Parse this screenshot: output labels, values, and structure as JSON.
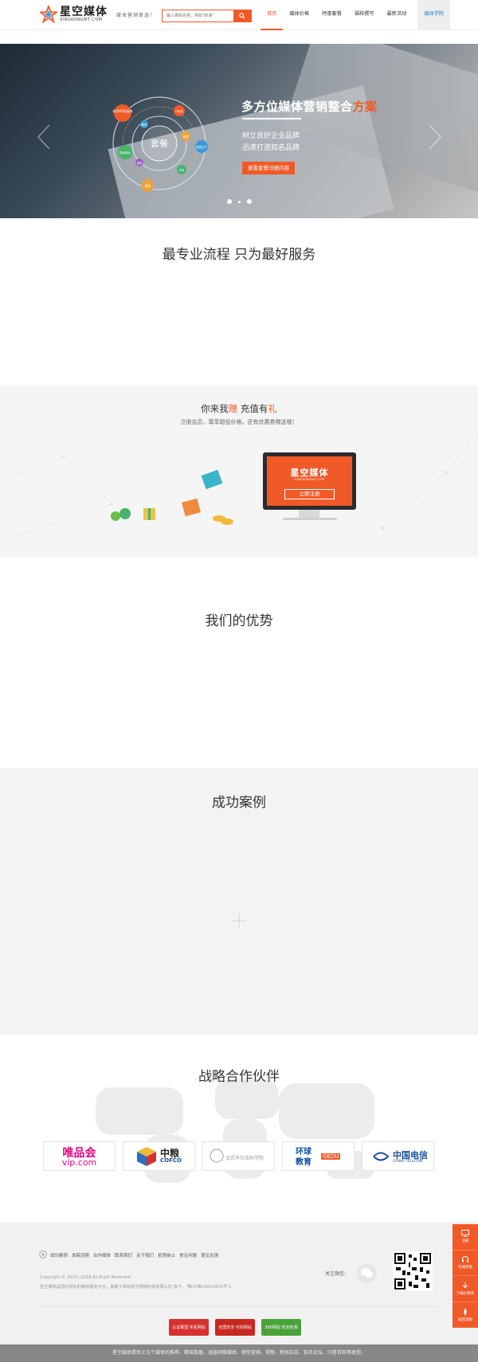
{
  "header": {
    "logo_cn": "星空媒体",
    "logo_en": "XINGKONGMT·COM",
    "slogan": "媒体营销首选！",
    "search_placeholder": "输入媒体名称，例如\"新浪\"",
    "nav": [
      "首页",
      "媒体价格",
      "特惠套餐",
      "福样撰写",
      "最新活动",
      "媒体学院"
    ]
  },
  "banner": {
    "title_main": "多方位媒体营销整合",
    "title_highlight": "方案",
    "line1": "树立良好企业品牌",
    "line2": "迅速打造知名品牌",
    "button": "查看套餐详细内容",
    "diagram_center": "套餐",
    "diagram_labels": [
      "综合60家媒体",
      "IT科技",
      "教育",
      "旅游",
      "家具生产",
      "汽车",
      "财经商业",
      "美容",
      "其他"
    ]
  },
  "section_process": {
    "title": "最专业流程 只为最好服务"
  },
  "register": {
    "title_a": "你来我",
    "title_b": "赠",
    "title_c": " 充值有",
    "title_d": "礼",
    "subtitle": "注册会员，尊享超低价格，还有优惠券赠送哦！",
    "monitor_brand": "星空媒体",
    "monitor_en": "XINGKONGMT·COM",
    "monitor_button": "立即注册"
  },
  "section_advantages": {
    "title": "我们的优势"
  },
  "section_cases": {
    "title": "成功案例"
  },
  "section_partners": {
    "title": "战略合作伙伴",
    "vip_a": "唯品会",
    "vip_b": "vip.com",
    "cofco_a": "中粮",
    "cofco_b": "COFCO",
    "gray_text": "北京市社会科学院",
    "gedu_a": "环球",
    "gedu_b": "教育",
    "gedu_c": "GEDU",
    "telecom_a": "中国电信",
    "telecom_b": "CHINA TELECOM"
  },
  "footer": {
    "links": [
      "成功案例",
      "发稿流程",
      "合作媒体",
      "联系我们",
      "关于我们",
      "招贤纳士",
      "常见问题",
      "意见反馈"
    ],
    "copyright": "Copyright © 2015~2018 All Right Reserved",
    "desc": "星空媒体是国内领先的媒体服务平台，隶属于郑州星空网络科技有限公司 旗下。 豫ICP备15015831号-1",
    "follow": "关注微信：",
    "badges": [
      "认证联盟 实名网站",
      "全国安全 可信网站",
      "360网站 安全检测"
    ],
    "bottom": "星空媒体提供上万个媒体的推荐、精准数据，涵盖网络媒体、微信营销、视频、新闻杂志、知名论坛、问答百科等类型。"
  },
  "float_bar": [
    "注册",
    "在线客服",
    "下载价格单",
    "返回顶部"
  ],
  "colors": {
    "accent": "#f05a28",
    "link_blue": "#1e7fd0"
  }
}
